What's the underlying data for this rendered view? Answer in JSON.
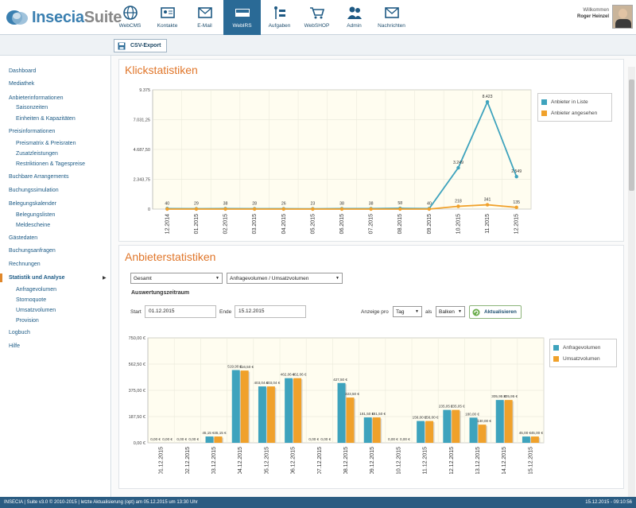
{
  "app": {
    "brand_part1": "Insecia",
    "brand_part2": "Suite"
  },
  "nav": [
    {
      "label": "WebCMS",
      "icon": "globe-icon"
    },
    {
      "label": "Kontakte",
      "icon": "contact-card-icon"
    },
    {
      "label": "E-Mail",
      "icon": "envelope-icon"
    },
    {
      "label": "WebIRS",
      "icon": "rooms-available-icon",
      "active": true
    },
    {
      "label": "Aufgaben",
      "icon": "tasks-icon"
    },
    {
      "label": "WebSHOP",
      "icon": "cart-icon"
    },
    {
      "label": "Admin",
      "icon": "users-icon"
    },
    {
      "label": "Nachrichten",
      "icon": "message-icon"
    }
  ],
  "user": {
    "greeting": "Willkommen",
    "name": "Roger Heinzel"
  },
  "toolbar": {
    "csv_label": "CSV-Export"
  },
  "sidebar": [
    {
      "label": "Dashboard",
      "level": 0
    },
    {
      "label": "Mediathek",
      "level": 0
    },
    {
      "label": "Anbieterinformationen",
      "level": 0
    },
    {
      "label": "Saisonzeiten",
      "level": 1
    },
    {
      "label": "Einheiten & Kapazitäten",
      "level": 1
    },
    {
      "label": "Preisinformationen",
      "level": 0
    },
    {
      "label": "Preismatrix & Preisraten",
      "level": 1
    },
    {
      "label": "Zusatzleistungen",
      "level": 1
    },
    {
      "label": "Restriktionen & Tagespreise",
      "level": 1
    },
    {
      "label": "Buchbare Arrangements",
      "level": 0
    },
    {
      "label": "Buchungssimulation",
      "level": 0
    },
    {
      "label": "Belegungskalender",
      "level": 0
    },
    {
      "label": "Belegungslisten",
      "level": 1
    },
    {
      "label": "Meldescheine",
      "level": 1
    },
    {
      "label": "Gästedaten",
      "level": 0
    },
    {
      "label": "Buchungsanfragen",
      "level": 0
    },
    {
      "label": "Rechnungen",
      "level": 0
    },
    {
      "label": "Statistik und Analyse",
      "level": 0,
      "active": true
    },
    {
      "label": "Anfragevolumen",
      "level": 1
    },
    {
      "label": "Stornoquote",
      "level": 1
    },
    {
      "label": "Umsatzvolumen",
      "level": 1
    },
    {
      "label": "Provision",
      "level": 1
    },
    {
      "label": "Logbuch",
      "level": 0
    },
    {
      "label": "Hilfe",
      "level": 0
    }
  ],
  "klick": {
    "title": "Klickstatistiken"
  },
  "anbieter": {
    "title": "Anbieterstatistiken",
    "select_scope": "Gesamt",
    "select_metric": "Anfragevolumen / Umsatzvolumen",
    "period_heading": "Auswertungszeitraum",
    "start_label": "Start",
    "start_value": "01.12.2015",
    "end_label": "Ende",
    "end_value": "15.12.2015",
    "display_label": "Anzeige pro",
    "display_value": "Tag",
    "as_label": "als",
    "as_value": "Balken",
    "update_label": "Aktualisieren"
  },
  "footer": {
    "left": "INSECIA | Suite v3.0 © 2010-2015 | letzte Aktualisierung (opt) am 05.12.2015 um 13:30 Uhr",
    "right": "15.12.2015 - 09:10:56"
  },
  "chart_data": [
    {
      "type": "line",
      "title": "Klickstatistiken",
      "categories": [
        "12.2014",
        "01.2015",
        "02.2015",
        "03.2015",
        "04.2015",
        "05.2015",
        "06.2015",
        "07.2015",
        "08.2015",
        "09.2015",
        "10.2015",
        "11.2015",
        "12.2015"
      ],
      "y_ticks": [
        "0",
        "2.343,75",
        "4.687,50",
        "7.031,25",
        "9.375"
      ],
      "ylim": [
        0,
        9375
      ],
      "series": [
        {
          "name": "Anbieter in Liste",
          "color": "#3ea3bd",
          "values": [
            40,
            29,
            38,
            28,
            26,
            23,
            38,
            38,
            58,
            40,
            3249,
            8423,
            2549
          ],
          "labels": [
            "40",
            "29",
            "38",
            "28",
            "26",
            "23",
            "38",
            "38",
            "58",
            "40",
            "3.249",
            "8.423",
            "2.549"
          ]
        },
        {
          "name": "Anbieter angesehen",
          "color": "#f0a12b",
          "values": [
            0,
            0,
            0,
            0,
            0,
            0,
            0,
            0,
            0,
            0,
            218,
            341,
            135
          ],
          "labels": [
            "",
            "",
            "",
            "",
            "",
            "",
            "",
            "",
            "",
            "",
            "218",
            "341",
            "135"
          ]
        }
      ],
      "legend": "right"
    },
    {
      "type": "bar",
      "title": "Anbieterstatistiken",
      "categories": [
        "01.12.2015",
        "02.12.2015",
        "03.12.2015",
        "04.12.2015",
        "05.12.2015",
        "06.12.2015",
        "07.12.2015",
        "08.12.2015",
        "09.12.2015",
        "10.12.2015",
        "11.12.2015",
        "12.12.2015",
        "13.12.2015",
        "14.12.2015",
        "15.12.2015"
      ],
      "y_ticks": [
        "0,00 €",
        "187,50 €",
        "375,00 €",
        "562,50 €",
        "750,00 €"
      ],
      "ylim": [
        0,
        750
      ],
      "series": [
        {
          "name": "Anfragevolumen",
          "color": "#3ea3bd",
          "values": [
            0,
            0,
            45.15,
            519.9,
            403.04,
            462.06,
            0,
            427.5,
            181.5,
            0,
            156.0,
            235.05,
            180.0,
            305.95,
            45.0
          ],
          "labels": [
            "0,00 €",
            "0,00 €",
            "45,15 €",
            "519,90 €",
            "403,04 €",
            "462,06 €",
            "0,00 €",
            "427,50 €",
            "181,50 €",
            "0,00 €",
            "156,00 €",
            "235,05 €",
            "180,00 €",
            "305,95 €",
            "45,00 €"
          ]
        },
        {
          "name": "Umsatzvolumen",
          "color": "#f0a12b",
          "values": [
            0,
            0,
            45.15,
            516.5,
            403.04,
            462.06,
            0,
            323.5,
            181.5,
            0,
            156.0,
            235.05,
            130.0,
            305.95,
            45.0
          ],
          "labels": [
            "0,00 €",
            "0,00 €",
            "45,15 €",
            "516,50 €",
            "403,04 €",
            "462,06 €",
            "0,00 €",
            "323,50 €",
            "181,50 €",
            "0,00 €",
            "156,00 €",
            "235,05 €",
            "130,00 €",
            "305,95 €",
            "45,00 €"
          ]
        }
      ],
      "legend": "right"
    }
  ]
}
